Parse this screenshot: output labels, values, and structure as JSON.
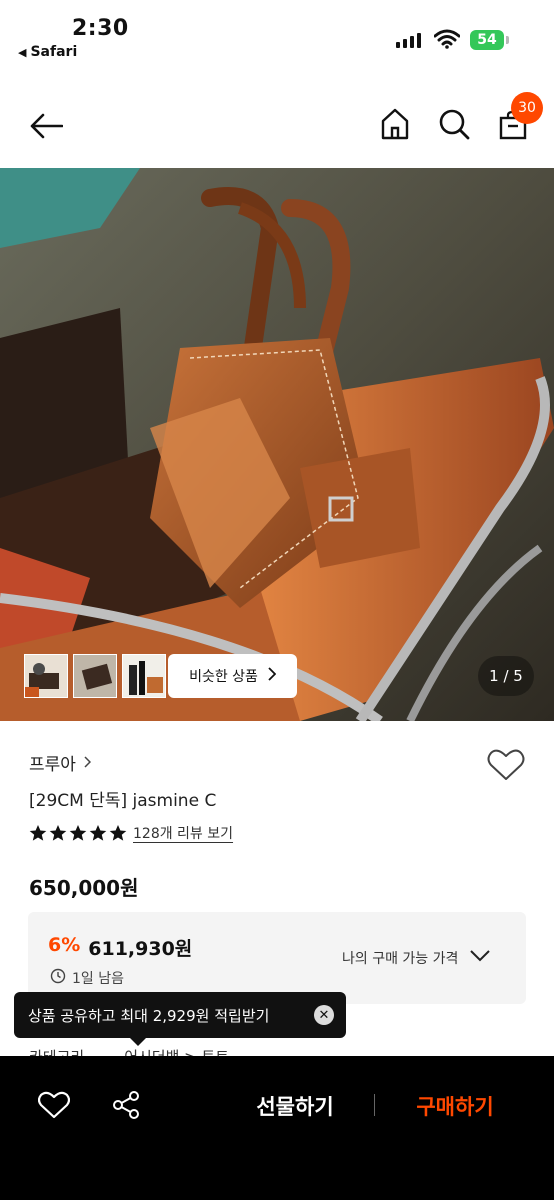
{
  "status_bar": {
    "time": "2:30",
    "back_app": "Safari",
    "battery": "54"
  },
  "nav": {
    "cart_count": "30"
  },
  "hero": {
    "similar_label": "비슷한 상품",
    "page_indicator": "1 / 5"
  },
  "product": {
    "brand": "프루아",
    "name": "[29CM 단독] jasmine C",
    "rating": 5,
    "review_link": "128개 리뷰 보기",
    "price": "650,000원"
  },
  "price_box": {
    "discount_rate": "6%",
    "discount_price": "611,930원",
    "remaining": "1일 남음",
    "my_price_label": "나의 구매 가능 가격"
  },
  "partial_row": {
    "left": "카테고리",
    "right": "어시더백 > 토트"
  },
  "tooltip": {
    "text": "상품 공유하고 최대 2,929원 적립받기"
  },
  "bottom_bar": {
    "gift_label": "선물하기",
    "buy_label": "구매하기"
  },
  "colors": {
    "accent": "#ff4800",
    "battery": "#34c759",
    "bottom_bar": "#000000"
  },
  "icons": [
    "back-arrow-icon",
    "home-icon",
    "search-icon",
    "shopping-bag-icon",
    "chevron-right-icon",
    "heart-icon",
    "star-icon",
    "clock-icon",
    "chevron-down-icon",
    "close-icon",
    "share-icon"
  ]
}
